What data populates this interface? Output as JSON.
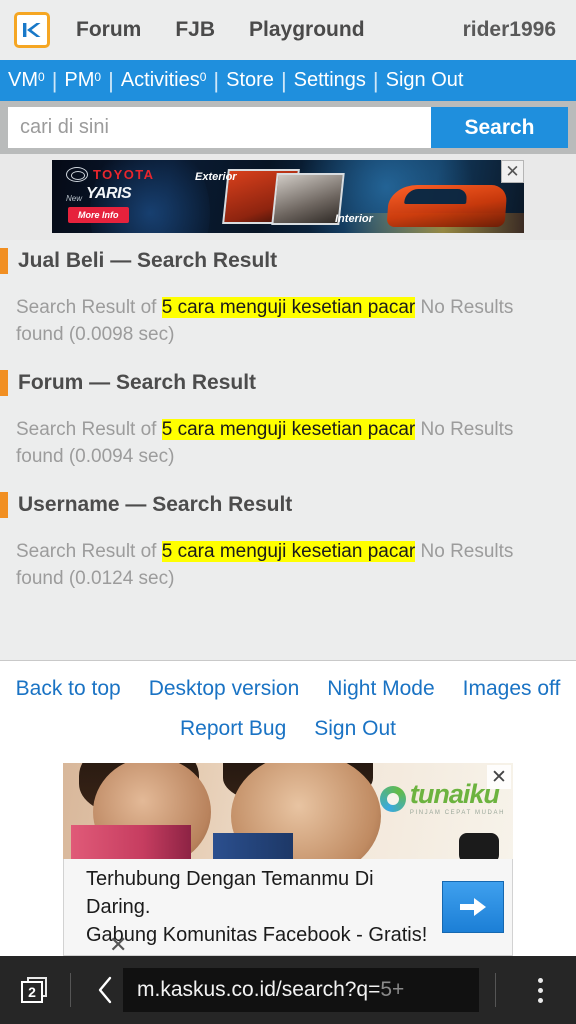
{
  "header": {
    "logo_alt": "kaskus-logo",
    "links": [
      "Forum",
      "FJB",
      "Playground"
    ],
    "username": "rider1996"
  },
  "nav": {
    "items": [
      {
        "label": "VM",
        "badge": "0"
      },
      {
        "label": "PM",
        "badge": "0"
      },
      {
        "label": "Activities",
        "badge": "0"
      },
      {
        "label": "Store",
        "badge": ""
      },
      {
        "label": "Settings",
        "badge": ""
      },
      {
        "label": "Sign Out",
        "badge": ""
      }
    ],
    "separator": "|"
  },
  "search": {
    "value": "",
    "placeholder": "cari di sini",
    "button_label": "Search"
  },
  "top_ad": {
    "brand": "TOYOTA",
    "model_prefix": "New",
    "model": "YARIS",
    "cta": "More Info",
    "label_left": "Exterior",
    "label_right": "Interior",
    "close_label": "✕"
  },
  "results": {
    "blocks": [
      {
        "title": "Jual Beli — Search Result",
        "prefix": "Search Result of ",
        "query": "5 cara menguji kesetian pacar",
        "suffix": " No Results found",
        "time": "(0.0098 sec)"
      },
      {
        "title": "Forum — Search Result",
        "prefix": "Search Result of ",
        "query": "5 cara menguji kesetian pacar",
        "suffix": " No Results found",
        "time": "(0.0094 sec)"
      },
      {
        "title": "Username — Search Result",
        "prefix": "Search Result of ",
        "query": "5 cara menguji kesetian pacar",
        "suffix": " No Results found",
        "time": "(0.0124 sec)"
      }
    ]
  },
  "footer": {
    "row1": [
      "Back to top",
      "Desktop version",
      "Night Mode",
      "Images off"
    ],
    "row2": [
      "Report Bug",
      "Sign Out"
    ]
  },
  "bottom_ad": {
    "sponsor": "tunaiku",
    "sponsor_tagline": "PINJAM CEPAT MUDAH",
    "line1": "Terhubung Dengan Temanmu Di Daring.",
    "line2": "Gabung Komunitas Facebook - Gratis!",
    "go_label": "➡",
    "close_label": "✕",
    "close_label_2": "✕"
  },
  "browser": {
    "tab_count": "2",
    "back_label": "‹",
    "url_main": "m.kaskus.co.id/search?q=",
    "url_tail": "5+",
    "menu_label": "menu"
  },
  "colors": {
    "accent_blue": "#1f8fdd",
    "accent_orange": "#f18f22",
    "highlight_yellow": "#ffff00",
    "link_blue": "#1a73c4",
    "page_bg": "#eceded"
  }
}
